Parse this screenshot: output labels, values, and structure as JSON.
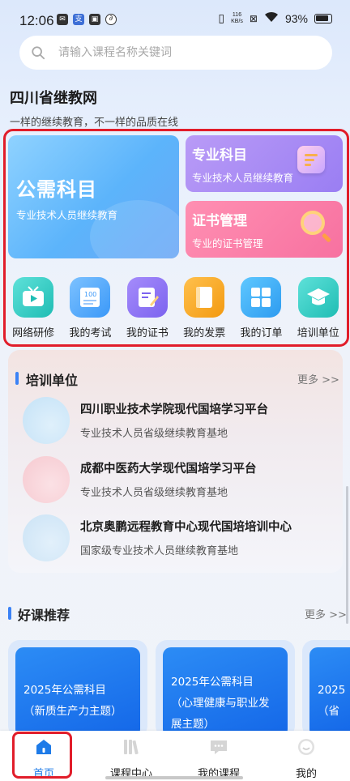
{
  "status": {
    "time": "12:06",
    "net_speed_value": "116",
    "net_speed_unit": "KB/s",
    "battery": "93%"
  },
  "search": {
    "placeholder": "请输入课程名称关键词"
  },
  "header": {
    "title": "四川省继教网",
    "slogan": "一样的继续教育，不一样的品质在线"
  },
  "cards": {
    "public": {
      "title": "公需科目",
      "subtitle": "专业技术人员继续教育"
    },
    "professional": {
      "title": "专业科目",
      "subtitle": "专业技术人员继续教育"
    },
    "certificate": {
      "title": "证书管理",
      "subtitle": "专业的证书管理"
    }
  },
  "shortcuts": [
    {
      "label": "网络研修",
      "icon": "video-icon"
    },
    {
      "label": "我的考试",
      "icon": "exam-icon"
    },
    {
      "label": "我的证书",
      "icon": "certificate-icon"
    },
    {
      "label": "我的发票",
      "icon": "invoice-icon"
    },
    {
      "label": "我的订单",
      "icon": "orders-icon"
    },
    {
      "label": "培训单位",
      "icon": "graduation-cap-icon"
    }
  ],
  "training_units": {
    "title": "培训单位",
    "more": "更多 >>",
    "items": [
      {
        "name": "四川职业技术学院现代国培学习平台",
        "desc": "专业技术人员省级继续教育基地"
      },
      {
        "name": "成都中医药大学现代国培学习平台",
        "desc": "专业技术人员省级继续教育基地"
      },
      {
        "name": "北京奥鹏远程教育中心现代国培培训中心",
        "desc": "国家级专业技术人员继续教育基地"
      }
    ]
  },
  "courses": {
    "title": "好课推荐",
    "more": "更多 >>",
    "items": [
      {
        "line1": "2025年公需科目",
        "line2": "（新质生产力主题）"
      },
      {
        "line1": "2025年公需科目",
        "line2": "（心理健康与职业发",
        "line3": "展主题）"
      },
      {
        "line1": "2025",
        "line2": "（省"
      }
    ]
  },
  "nav": {
    "items": [
      {
        "label": "首页",
        "icon": "home-icon"
      },
      {
        "label": "课程中心",
        "icon": "books-icon"
      },
      {
        "label": "我的课程",
        "icon": "chat-icon"
      },
      {
        "label": "我的",
        "icon": "smile-icon"
      }
    ],
    "active_color": "#1e7be8"
  },
  "colors": {
    "accent": "#3b82f6",
    "highlight": "#e11d2a"
  }
}
